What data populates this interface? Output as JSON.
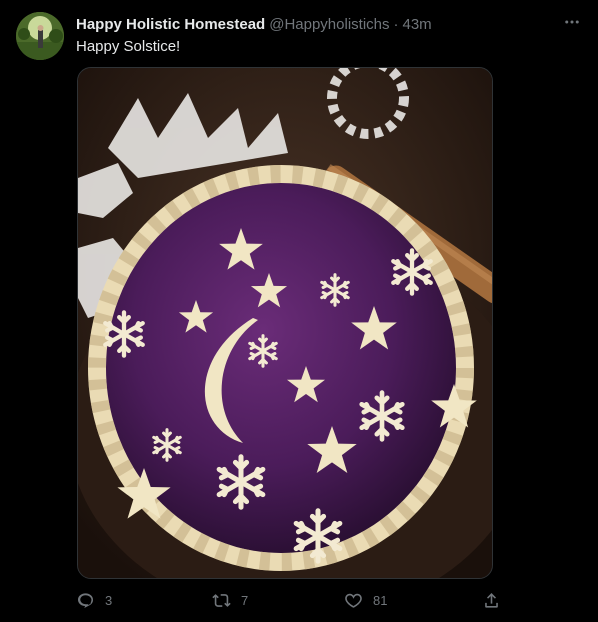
{
  "tweet": {
    "author": {
      "name": "Happy Holistic Homestead",
      "handle": "@Happyholistichs",
      "avatar_icon": "profile-photo"
    },
    "separator": "·",
    "time": "43m",
    "text": "Happy Solstice!",
    "media": {
      "icon": "photo"
    },
    "actions": {
      "reply_count": "3",
      "retweet_count": "7",
      "like_count": "81"
    }
  },
  "colors": {
    "background": "#000000",
    "text": "#e7e9ea",
    "muted": "#71767b",
    "border": "#2f3336"
  }
}
